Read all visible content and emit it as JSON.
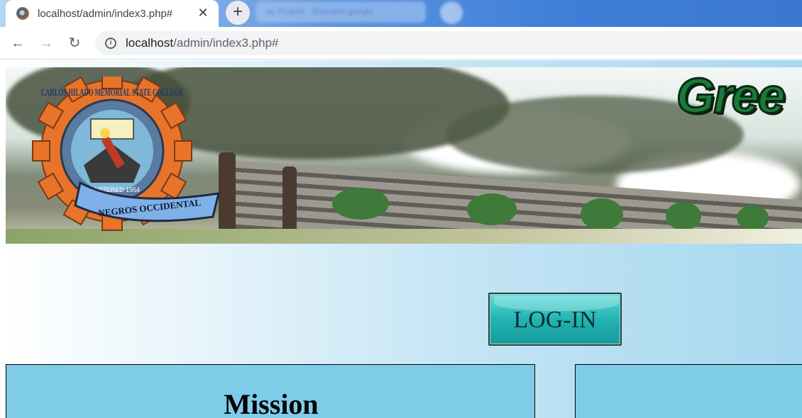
{
  "browser": {
    "tab_title": "localhost/admin/index3.php#",
    "close_glyph": "✕",
    "newtab_glyph": "+",
    "url_host": "localhost",
    "url_path": "/admin/index3.php#",
    "back_glyph": "←",
    "forward_glyph": "→",
    "reload_glyph": "↻",
    "info_glyph": "i"
  },
  "banner": {
    "seal_top_text": "CARLOS HILADO MEMORIAL STATE COLLEGE",
    "seal_chartered": "CHARTERED 1954",
    "seal_bottom_text": "NEGROS OCCIDENTAL",
    "title_partial": "Gree"
  },
  "page": {
    "login_label": "LOG-IN",
    "mission_heading": "Mission"
  },
  "icons": {
    "favicon": "college-seal-icon",
    "back": "back-arrow-icon",
    "forward": "forward-arrow-icon",
    "reload": "reload-icon",
    "info": "info-icon",
    "close": "close-icon",
    "new_tab": "plus-icon"
  },
  "colors": {
    "panel": "#7fcce9",
    "button": "#23b3b3",
    "title_green": "#1a7a3a"
  }
}
